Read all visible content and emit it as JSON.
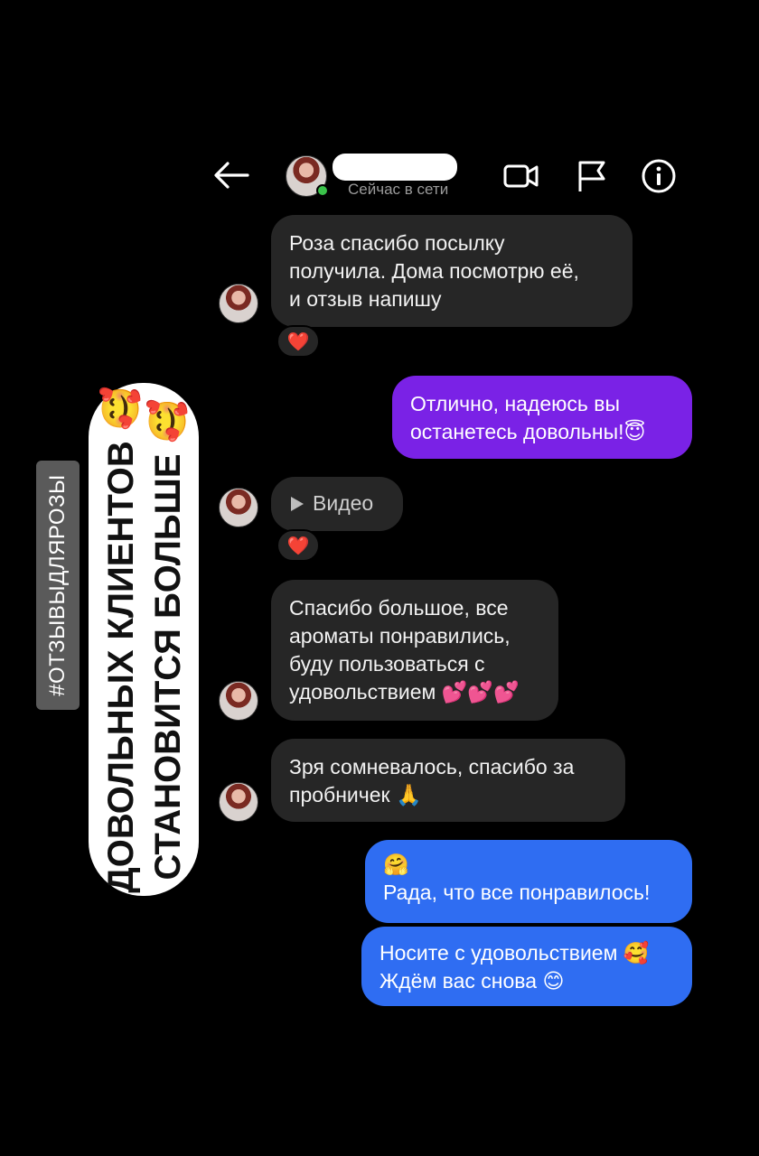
{
  "header": {
    "status": "Сейчас в сети",
    "icons": [
      "back-arrow-icon",
      "video-call-icon",
      "flag-icon",
      "info-icon"
    ]
  },
  "side": {
    "hashtag": "#ОТЗЫВЫДЛЯРОЗЫ",
    "banner_line1": "ДОВОЛЬНЫХ КЛИЕНТОВ",
    "banner_line2": "СТАНОВИТСЯ БОЛЬШЕ",
    "banner_emoji_top": "🥰",
    "banner_emoji_end": "🥰"
  },
  "messages": [
    {
      "type": "incoming",
      "line1": "Роза спасибо посылку",
      "line2": "получила. Дома посмотрю её,",
      "line3": "и отзыв напишу",
      "reaction": "❤️"
    },
    {
      "type": "sent",
      "line1": "Отлично, надеюсь вы",
      "line2": "останетесь довольны!",
      "emoji": "😇"
    },
    {
      "type": "incoming-video",
      "label": "Видео",
      "reaction": "❤️"
    },
    {
      "type": "incoming",
      "line1": "Спасибо большое, все",
      "line2": "ароматы понравились,",
      "line3": "буду пользоваться с",
      "line4": "удовольствием",
      "emoji": "💕💕💕"
    },
    {
      "type": "incoming",
      "line1": "Зря сомневалось, спасибо за",
      "line2": "пробничек",
      "emoji": "🙏"
    },
    {
      "type": "sent",
      "emoji_top": "🤗",
      "line1": "Рада, что все понравилось!"
    },
    {
      "type": "sent",
      "line1": "Носите с удовольствием",
      "emoji1": "🥰",
      "line2": "Ждём вас снова",
      "emoji2": "😊"
    }
  ],
  "colors": {
    "background": "#000000",
    "incoming_bubble": "#262626",
    "sent_purple": "#7a22e6",
    "sent_blue": "#2f6df2",
    "online": "#3ac24a"
  }
}
